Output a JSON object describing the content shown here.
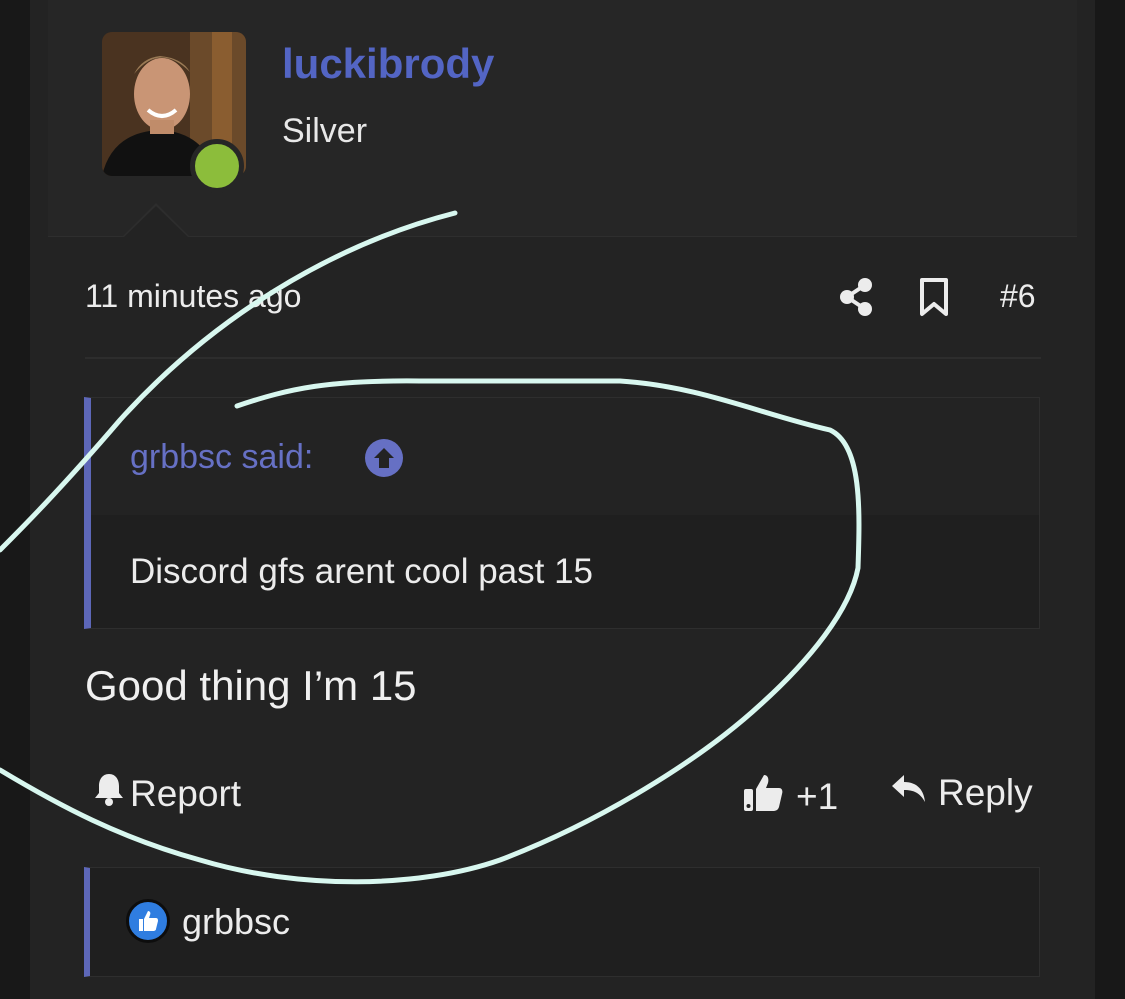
{
  "post": {
    "username": "luckibrody",
    "rank": "Silver",
    "timestamp": "11 minutes ago",
    "post_number": "#6",
    "quote": {
      "author": "grbbsc said:",
      "text": "Discord gfs arent cool past 15"
    },
    "message": "Good thing I’m 15",
    "actions": {
      "report_label": "Report",
      "like_count": "+1",
      "reply_label": "Reply"
    },
    "likes": {
      "user": "grbbsc"
    }
  },
  "colors": {
    "accent": "#5365c4",
    "online": "#8cbd3b",
    "annotation": "#d8f7ef"
  },
  "icons": {
    "share": "share-icon",
    "bookmark": "bookmark-icon",
    "quote_jump": "arrow-up-circle-icon",
    "report": "bell-icon",
    "like": "thumbs-up-icon",
    "reply": "reply-icon",
    "likes_badge": "like-badge-icon"
  }
}
